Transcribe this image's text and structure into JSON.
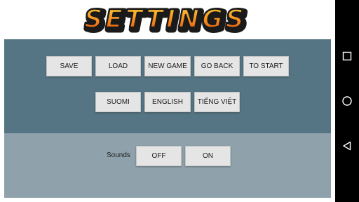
{
  "header": {
    "title": "SETTINGS"
  },
  "menu": {
    "save": "SAVE",
    "load": "LOAD",
    "new_game": "NEW GAME",
    "go_back": "GO BACK",
    "to_start": "TO START"
  },
  "languages": {
    "finnish": "SUOMI",
    "english": "ENGLISH",
    "vietnamese": "TIẾNG VIỆT"
  },
  "sounds": {
    "label": "Sounds",
    "off": "OFF",
    "on": "ON"
  },
  "colors": {
    "top_panel": "#557584",
    "bottom_panel": "#8fa2ac",
    "logo_fill": "#f07a18",
    "button": "#e5e5e5"
  },
  "system_nav": {
    "icons": [
      "recent-apps-icon",
      "home-icon",
      "back-icon"
    ]
  }
}
